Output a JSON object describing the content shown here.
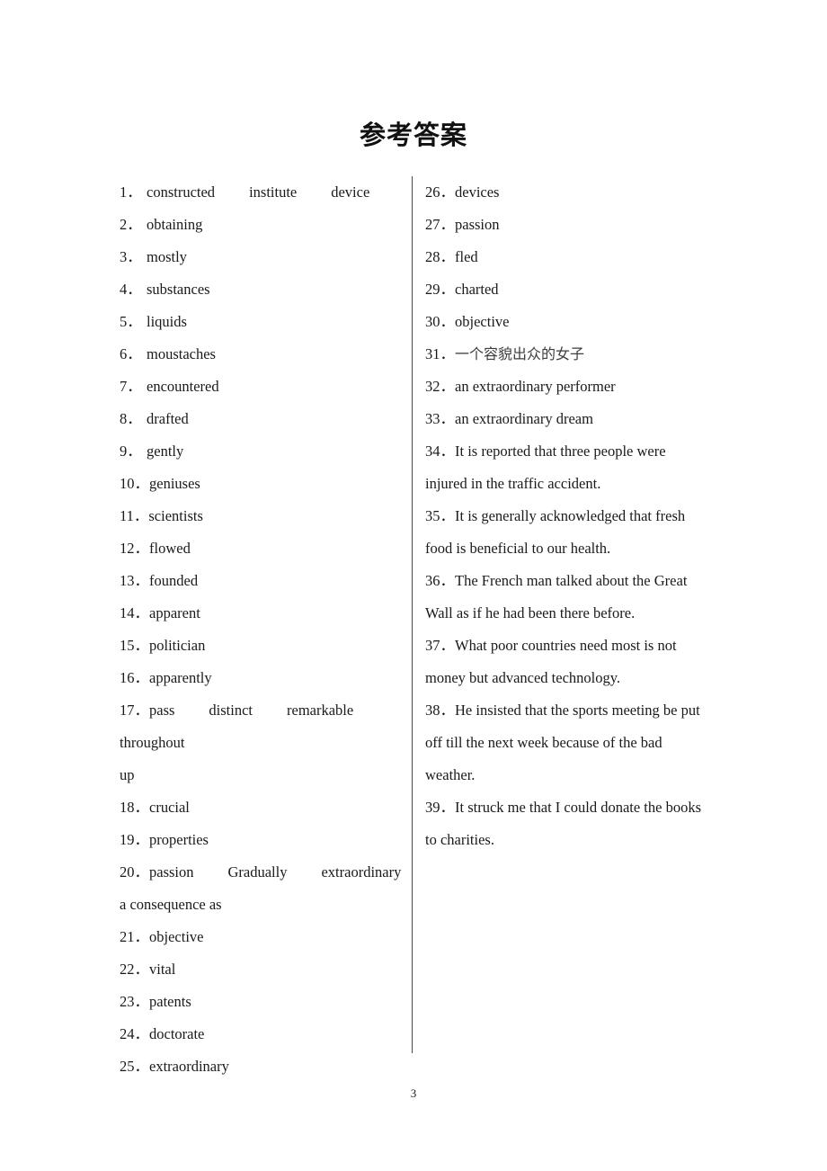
{
  "document": {
    "title": "参考答案",
    "page_number": "3"
  },
  "left_column": {
    "items": [
      {
        "num": "1．",
        "words": [
          "constructed",
          "institute",
          "device"
        ]
      },
      {
        "num": "2．",
        "words": [
          "obtaining"
        ]
      },
      {
        "num": "3．",
        "words": [
          "mostly"
        ]
      },
      {
        "num": "4．",
        "words": [
          "substances"
        ]
      },
      {
        "num": "5．",
        "words": [
          "liquids"
        ]
      },
      {
        "num": "6．",
        "words": [
          "moustaches"
        ]
      },
      {
        "num": "7．",
        "words": [
          "encountered"
        ]
      },
      {
        "num": "8．",
        "words": [
          "drafted"
        ]
      },
      {
        "num": "9．",
        "words": [
          "gently"
        ]
      },
      {
        "num": "10．",
        "words": [
          "geniuses"
        ]
      },
      {
        "num": "11．",
        "words": [
          "scientists"
        ]
      },
      {
        "num": "12．",
        "words": [
          "flowed"
        ]
      },
      {
        "num": "13．",
        "words": [
          "founded"
        ]
      },
      {
        "num": "14．",
        "words": [
          "apparent"
        ]
      },
      {
        "num": "15．",
        "words": [
          "politician"
        ]
      },
      {
        "num": "16．",
        "words": [
          "apparently"
        ]
      },
      {
        "num": "17．",
        "words": [
          "pass",
          "distinct",
          "remarkable"
        ],
        "continuation": [
          "throughout",
          "up"
        ]
      },
      {
        "num": "18．",
        "words": [
          "crucial"
        ]
      },
      {
        "num": "19．",
        "words": [
          "properties"
        ]
      },
      {
        "num": "20．",
        "words": [
          "passion",
          "Gradually",
          "extraordinary"
        ],
        "continuation": [
          "a consequence as"
        ]
      },
      {
        "num": "21．",
        "words": [
          "objective"
        ]
      },
      {
        "num": "22．",
        "words": [
          "vital"
        ]
      },
      {
        "num": "23．",
        "words": [
          "patents"
        ]
      },
      {
        "num": "24．",
        "words": [
          "doctorate"
        ]
      },
      {
        "num": "25．",
        "words": [
          "extraordinary"
        ]
      }
    ]
  },
  "right_column": {
    "items": [
      {
        "num": "26．",
        "words": [
          "devices"
        ]
      },
      {
        "num": "27．",
        "words": [
          "passion"
        ]
      },
      {
        "num": "28．",
        "words": [
          "fled"
        ]
      },
      {
        "num": "29．",
        "words": [
          "charted"
        ]
      },
      {
        "num": "30．",
        "words": [
          "objective"
        ]
      },
      {
        "num": "31．",
        "words": [
          "一个容貌出众的女子"
        ],
        "cjk": true
      },
      {
        "num": "32．",
        "words": [
          "an extraordinary performer"
        ]
      },
      {
        "num": "33．",
        "words": [
          "an extraordinary dream"
        ]
      },
      {
        "num": "34．",
        "words": [
          "It is reported that three people were"
        ],
        "continuation": [
          "injured in the traffic accident."
        ]
      },
      {
        "num": "35．",
        "words": [
          "It is generally acknowledged that fresh"
        ],
        "continuation": [
          "food is beneficial to our health."
        ]
      },
      {
        "num": "36．",
        "words": [
          "The French man talked about the Great"
        ],
        "continuation": [
          "Wall as if he had been there before."
        ]
      },
      {
        "num": "37．",
        "words": [
          "What poor countries need most is not"
        ],
        "continuation": [
          "money but advanced technology."
        ]
      },
      {
        "num": "38．",
        "words": [
          "He insisted that the sports meeting be put"
        ],
        "continuation": [
          "off till the next week because of the bad",
          "weather."
        ]
      },
      {
        "num": "39．",
        "words": [
          "It struck me that I could donate the books"
        ],
        "continuation": [
          "to charities."
        ]
      }
    ]
  },
  "colors": {
    "text": "#1a1a1a",
    "divider": "#4a4a4a",
    "background": "#ffffff"
  }
}
